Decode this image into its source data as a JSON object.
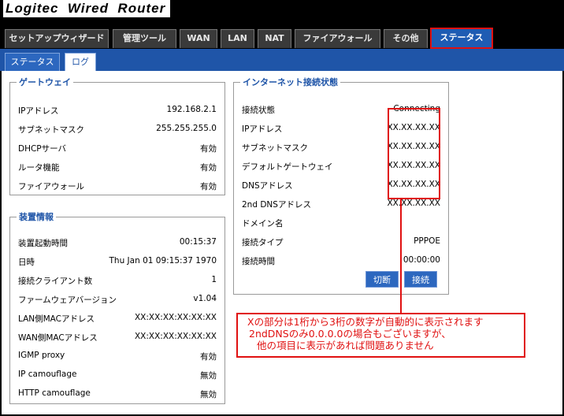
{
  "header": {
    "title": "Logitec  Wired  Router"
  },
  "tabs": [
    {
      "label": "セットアップウィザード"
    },
    {
      "label": "管理ツール"
    },
    {
      "label": "WAN"
    },
    {
      "label": "LAN"
    },
    {
      "label": "NAT"
    },
    {
      "label": "ファイアウォール"
    },
    {
      "label": "その他"
    },
    {
      "label": "ステータス"
    }
  ],
  "subtabs": [
    {
      "label": "ステータス"
    },
    {
      "label": "ログ"
    }
  ],
  "gateway": {
    "legend": "ゲートウェイ",
    "rows": [
      {
        "k": "IPアドレス",
        "v": "192.168.2.1"
      },
      {
        "k": "サブネットマスク",
        "v": "255.255.255.0"
      },
      {
        "k": "DHCPサーバ",
        "v": "有効"
      },
      {
        "k": "ルータ機能",
        "v": "有効"
      },
      {
        "k": "ファイアウォール",
        "v": "有効"
      }
    ]
  },
  "device": {
    "legend": "装置情報",
    "rows": [
      {
        "k": "装置起動時間",
        "v": "00:15:37"
      },
      {
        "k": "日時",
        "v": "Thu Jan 01 09:15:37 1970"
      },
      {
        "k": "接続クライアント数",
        "v": "1"
      },
      {
        "k": "ファームウェアバージョン",
        "v": "v1.04"
      },
      {
        "k": "LAN側MACアドレス",
        "v": "XX:XX:XX:XX:XX:XX"
      },
      {
        "k": "WAN側MACアドレス",
        "v": "XX:XX:XX:XX:XX:XX"
      },
      {
        "k": "IGMP proxy",
        "v": "有効"
      },
      {
        "k": "IP camouflage",
        "v": "無効"
      },
      {
        "k": "HTTP camouflage",
        "v": "無効"
      }
    ]
  },
  "internet": {
    "legend": "インターネット接続状態",
    "rows": [
      {
        "k": "接続状態",
        "v": "Connecting"
      },
      {
        "k": "IPアドレス",
        "v": "XX.XX.XX.XX"
      },
      {
        "k": "サブネットマスク",
        "v": "XX.XX.XX.XX"
      },
      {
        "k": "デフォルトゲートウェイ",
        "v": "XX.XX.XX.XX"
      },
      {
        "k": "DNSアドレス",
        "v": "XX.XX.XX.XX"
      },
      {
        "k": "2nd DNSアドレス",
        "v": "XX.XX.XX.XX"
      },
      {
        "k": "ドメイン名",
        "v": ""
      },
      {
        "k": "接続タイプ",
        "v": "PPPOE"
      },
      {
        "k": "接続時間",
        "v": "00:00:00"
      }
    ],
    "disconnect_label": "切断",
    "connect_label": "接続"
  },
  "note": {
    "lines": [
      "Xの部分は1桁から3桁の数字が自動的に表示されます",
      "2ndDNSのみ0.0.0.0の場合もございますが、",
      "他の項目に表示があれば問題ありません"
    ]
  },
  "colors": {
    "accent": "#1f55a8",
    "highlight": "#e01010"
  }
}
